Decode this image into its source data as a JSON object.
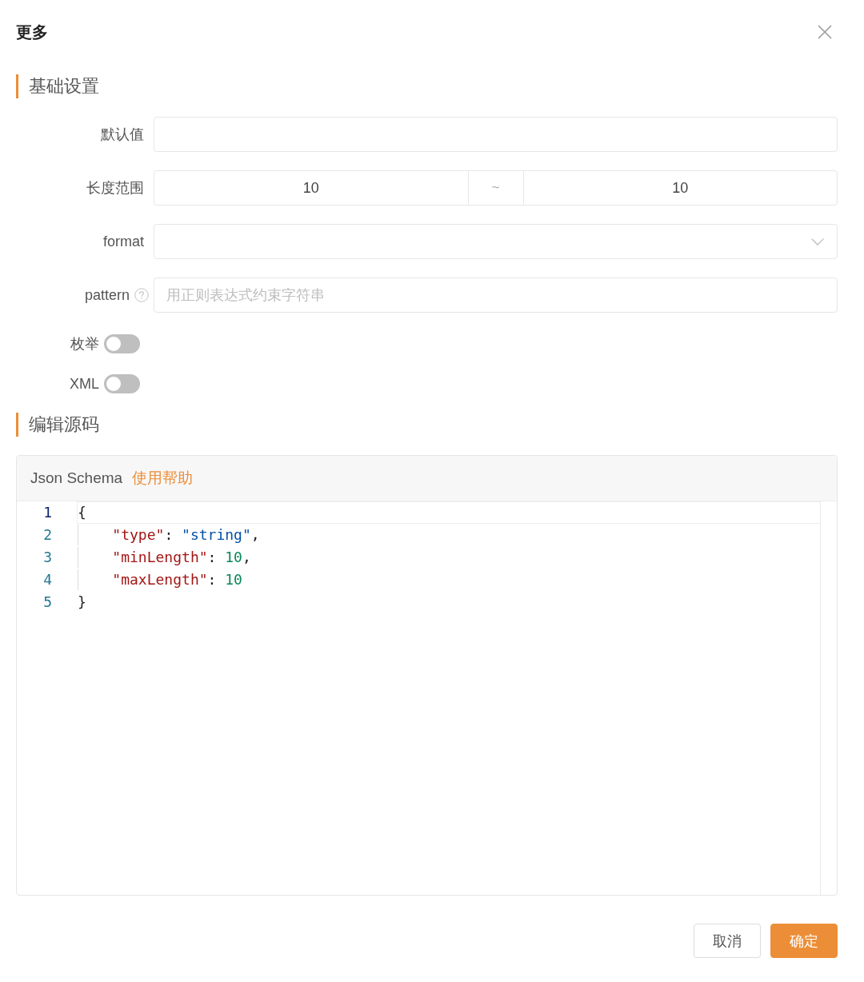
{
  "dialog": {
    "title": "更多"
  },
  "basic_section": {
    "title": "基础设置",
    "fields": [
      {
        "kind": "input",
        "label": "默认值",
        "help": false
      },
      {
        "kind": "range",
        "label": "长度范围",
        "help": false,
        "min": "10",
        "separator": "~",
        "max": "10"
      },
      {
        "kind": "select",
        "label": "format",
        "help": false
      },
      {
        "kind": "input",
        "label": "pattern",
        "help": true,
        "placeholder": "用正则表达式约束字符串"
      }
    ],
    "switches": [
      {
        "label": "枚举",
        "on": false
      },
      {
        "label": "XML",
        "on": false
      }
    ]
  },
  "source_section": {
    "title": "编辑源码",
    "editor": {
      "header_title": "Json Schema",
      "help_link": "使用帮助",
      "lines": [
        {
          "number": "1",
          "active": true,
          "tokens": [
            {
              "kind": "punct",
              "text": "{"
            }
          ],
          "children": [
            {
              "number": "2",
              "active": false,
              "tokens": [
                {
                  "kind": "key",
                  "text": "\"type\""
                },
                {
                  "kind": "punct",
                  "text": ": "
                },
                {
                  "kind": "string",
                  "text": "\"string\""
                },
                {
                  "kind": "punct",
                  "text": ","
                }
              ]
            },
            {
              "number": "3",
              "active": false,
              "tokens": [
                {
                  "kind": "key",
                  "text": "\"minLength\""
                },
                {
                  "kind": "punct",
                  "text": ": "
                },
                {
                  "kind": "number",
                  "text": "10"
                },
                {
                  "kind": "punct",
                  "text": ","
                }
              ]
            },
            {
              "number": "4",
              "active": false,
              "tokens": [
                {
                  "kind": "key",
                  "text": "\"maxLength\""
                },
                {
                  "kind": "punct",
                  "text": ": "
                },
                {
                  "kind": "number",
                  "text": "10"
                }
              ]
            }
          ]
        },
        {
          "number": "5",
          "active": false,
          "tokens": [
            {
              "kind": "punct",
              "text": "}"
            }
          ]
        }
      ]
    }
  },
  "footer": {
    "buttons": [
      {
        "kind": "default",
        "label": "取消"
      },
      {
        "kind": "primary",
        "label": "确定"
      }
    ]
  }
}
